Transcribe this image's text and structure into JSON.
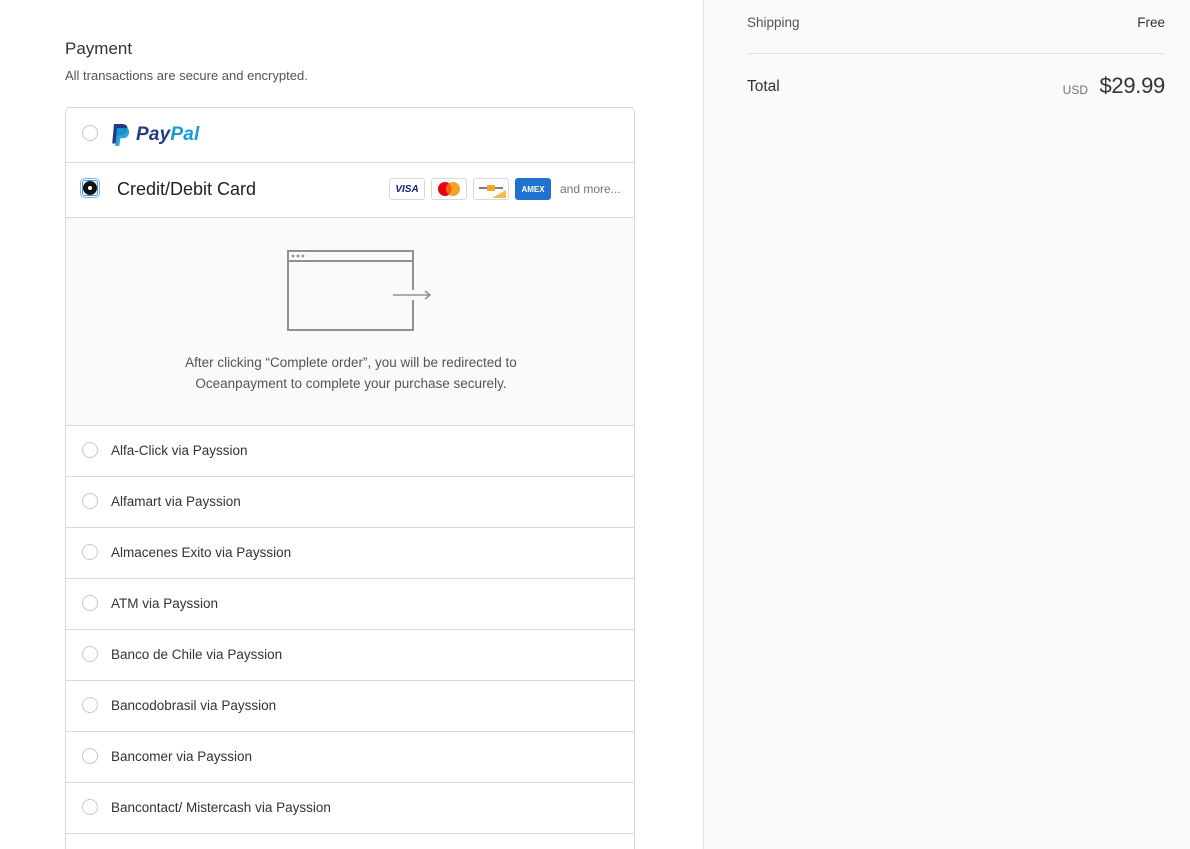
{
  "payment": {
    "title": "Payment",
    "subtitle": "All transactions are secure and encrypted."
  },
  "methods": {
    "paypal": {
      "pay": "Pay",
      "pal": "Pal",
      "selected": false
    },
    "card": {
      "label": "Credit/Debit Card",
      "selected": true,
      "icons": [
        "VISA",
        "mastercard",
        "maestro",
        "AMEX"
      ],
      "visa_text": "VISA",
      "amex_text": "AMEX",
      "more": "and more..."
    },
    "redirect": {
      "line1": "After clicking “Complete order”, you will be redirected to",
      "line2": "Oceanpayment to complete your purchase securely."
    },
    "options": [
      {
        "label": "Alfa-Click via Payssion"
      },
      {
        "label": "Alfamart via Payssion"
      },
      {
        "label": "Almacenes Exito via Payssion"
      },
      {
        "label": "ATM via Payssion"
      },
      {
        "label": "Banco de Chile via Payssion"
      },
      {
        "label": "Bancodobrasil via Payssion"
      },
      {
        "label": "Bancomer via Payssion"
      },
      {
        "label": "Bancontact/ Mistercash via Payssion"
      }
    ]
  },
  "summary": {
    "shipping_label": "Shipping",
    "shipping_value": "Free",
    "total_label": "Total",
    "currency": "USD",
    "total_amount": "$29.99"
  },
  "colors": {
    "paypal_dark": "#253b80",
    "paypal_light": "#179bd7",
    "amex": "#1f72cd",
    "border": "#d9d9d9",
    "sidebar_bg": "#fafafa"
  }
}
